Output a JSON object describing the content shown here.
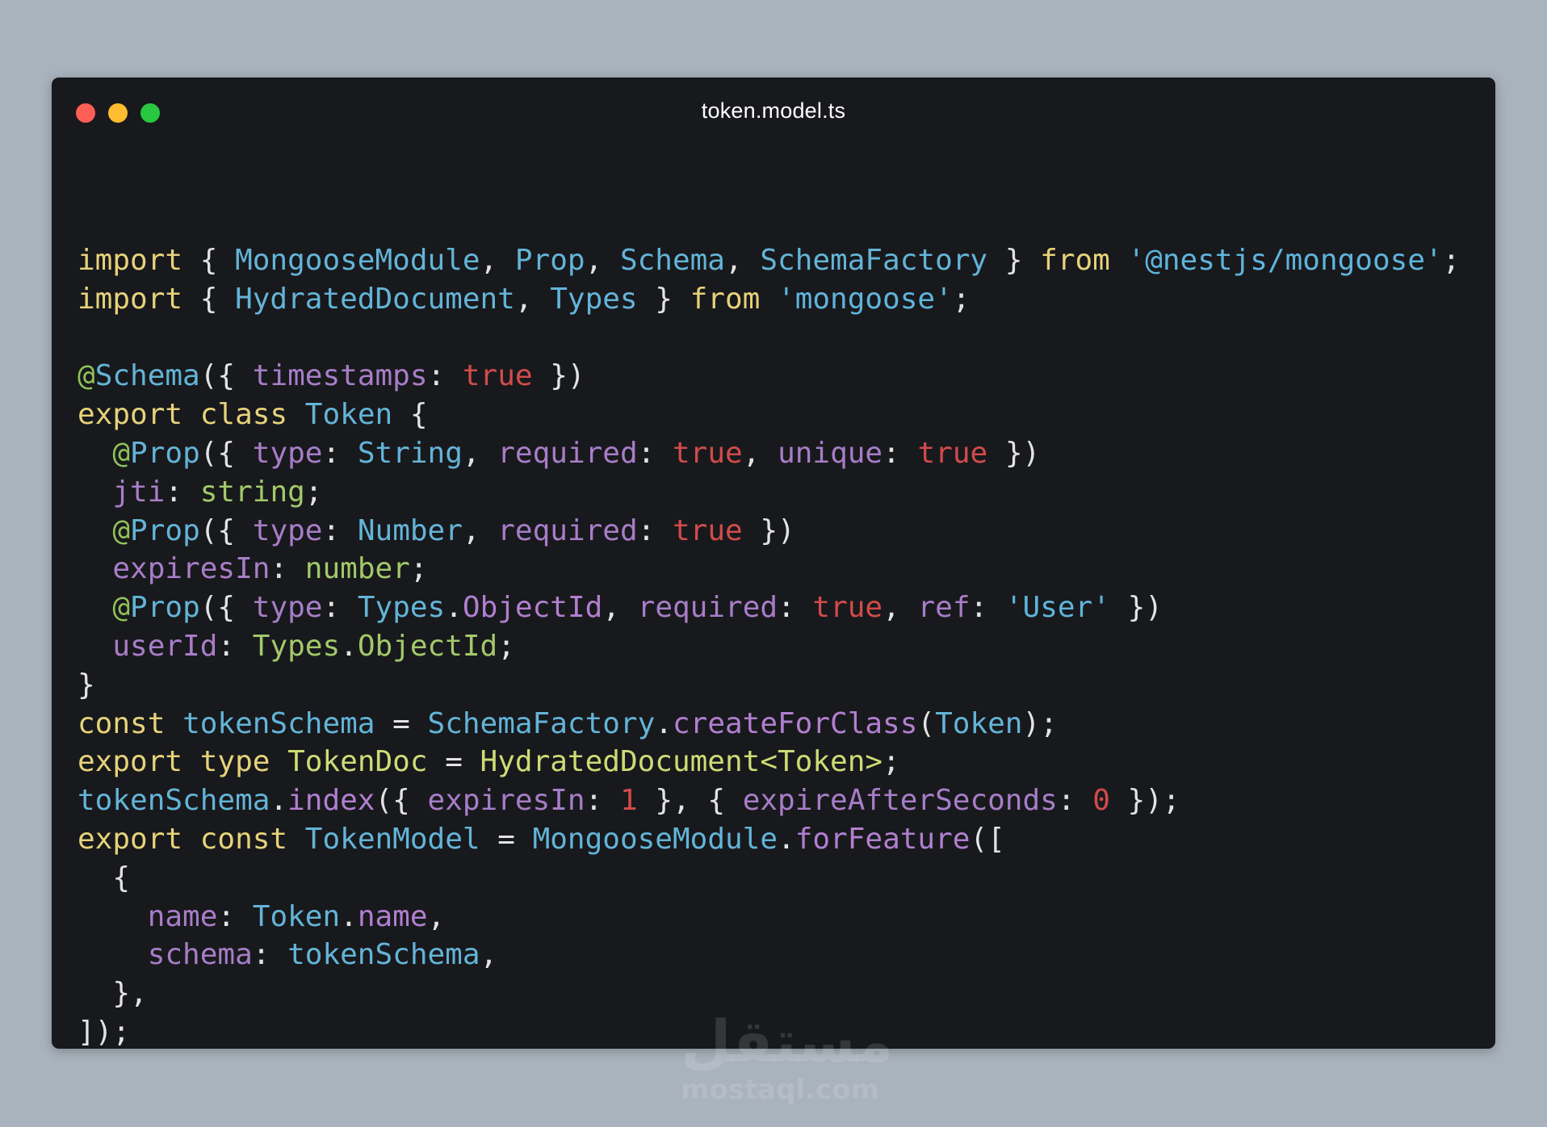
{
  "window": {
    "filename": "token.model.ts",
    "buttons": {
      "close": "close",
      "minimize": "minimize",
      "maximize": "maximize"
    }
  },
  "colors": {
    "background": "#a9b3bd",
    "editor": "#18191c",
    "keyword": "#e6d27a",
    "type": "#63b4d8",
    "string": "#5fb4dc",
    "property": "#a77dc8",
    "literal": "#d14b4b",
    "decorator": "#8fc35a",
    "primitive": "#a2c96b"
  },
  "code_lines": [
    [
      {
        "c": "keyword",
        "t": "import"
      },
      {
        "c": "plain",
        "t": " { "
      },
      {
        "c": "type",
        "t": "MongooseModule"
      },
      {
        "c": "plain",
        "t": ", "
      },
      {
        "c": "type",
        "t": "Prop"
      },
      {
        "c": "plain",
        "t": ", "
      },
      {
        "c": "type",
        "t": "Schema"
      },
      {
        "c": "plain",
        "t": ", "
      },
      {
        "c": "type",
        "t": "SchemaFactory"
      },
      {
        "c": "plain",
        "t": " } "
      },
      {
        "c": "keyword",
        "t": "from"
      },
      {
        "c": "plain",
        "t": " "
      },
      {
        "c": "string",
        "t": "'@nestjs/mongoose'"
      },
      {
        "c": "plain",
        "t": ";"
      }
    ],
    [
      {
        "c": "keyword",
        "t": "import"
      },
      {
        "c": "plain",
        "t": " { "
      },
      {
        "c": "type",
        "t": "HydratedDocument"
      },
      {
        "c": "plain",
        "t": ", "
      },
      {
        "c": "type",
        "t": "Types"
      },
      {
        "c": "plain",
        "t": " } "
      },
      {
        "c": "keyword",
        "t": "from"
      },
      {
        "c": "plain",
        "t": " "
      },
      {
        "c": "string",
        "t": "'mongoose'"
      },
      {
        "c": "plain",
        "t": ";"
      }
    ],
    [],
    [
      {
        "c": "decorator",
        "t": "@"
      },
      {
        "c": "type",
        "t": "Schema"
      },
      {
        "c": "plain",
        "t": "({ "
      },
      {
        "c": "prop",
        "t": "timestamps"
      },
      {
        "c": "plain",
        "t": ": "
      },
      {
        "c": "value",
        "t": "true"
      },
      {
        "c": "plain",
        "t": " })"
      }
    ],
    [
      {
        "c": "keyword",
        "t": "export"
      },
      {
        "c": "plain",
        "t": " "
      },
      {
        "c": "keyword",
        "t": "class"
      },
      {
        "c": "plain",
        "t": " "
      },
      {
        "c": "type",
        "t": "Token"
      },
      {
        "c": "plain",
        "t": " {"
      }
    ],
    [
      {
        "c": "plain",
        "t": "  "
      },
      {
        "c": "decorator",
        "t": "@"
      },
      {
        "c": "type",
        "t": "Prop"
      },
      {
        "c": "plain",
        "t": "({ "
      },
      {
        "c": "prop",
        "t": "type"
      },
      {
        "c": "plain",
        "t": ": "
      },
      {
        "c": "type",
        "t": "String"
      },
      {
        "c": "plain",
        "t": ", "
      },
      {
        "c": "prop",
        "t": "required"
      },
      {
        "c": "plain",
        "t": ": "
      },
      {
        "c": "value",
        "t": "true"
      },
      {
        "c": "plain",
        "t": ", "
      },
      {
        "c": "prop",
        "t": "unique"
      },
      {
        "c": "plain",
        "t": ": "
      },
      {
        "c": "value",
        "t": "true"
      },
      {
        "c": "plain",
        "t": " })"
      }
    ],
    [
      {
        "c": "plain",
        "t": "  "
      },
      {
        "c": "prop",
        "t": "jti"
      },
      {
        "c": "plain",
        "t": ": "
      },
      {
        "c": "prim",
        "t": "string"
      },
      {
        "c": "plain",
        "t": ";"
      }
    ],
    [
      {
        "c": "plain",
        "t": "  "
      },
      {
        "c": "decorator",
        "t": "@"
      },
      {
        "c": "type",
        "t": "Prop"
      },
      {
        "c": "plain",
        "t": "({ "
      },
      {
        "c": "prop",
        "t": "type"
      },
      {
        "c": "plain",
        "t": ": "
      },
      {
        "c": "type",
        "t": "Number"
      },
      {
        "c": "plain",
        "t": ", "
      },
      {
        "c": "prop",
        "t": "required"
      },
      {
        "c": "plain",
        "t": ": "
      },
      {
        "c": "value",
        "t": "true"
      },
      {
        "c": "plain",
        "t": " })"
      }
    ],
    [
      {
        "c": "plain",
        "t": "  "
      },
      {
        "c": "prop",
        "t": "expiresIn"
      },
      {
        "c": "plain",
        "t": ": "
      },
      {
        "c": "prim",
        "t": "number"
      },
      {
        "c": "plain",
        "t": ";"
      }
    ],
    [
      {
        "c": "plain",
        "t": "  "
      },
      {
        "c": "decorator",
        "t": "@"
      },
      {
        "c": "type",
        "t": "Prop"
      },
      {
        "c": "plain",
        "t": "({ "
      },
      {
        "c": "prop",
        "t": "type"
      },
      {
        "c": "plain",
        "t": ": "
      },
      {
        "c": "type",
        "t": "Types"
      },
      {
        "c": "plain",
        "t": "."
      },
      {
        "c": "method",
        "t": "ObjectId"
      },
      {
        "c": "plain",
        "t": ", "
      },
      {
        "c": "prop",
        "t": "required"
      },
      {
        "c": "plain",
        "t": ": "
      },
      {
        "c": "value",
        "t": "true"
      },
      {
        "c": "plain",
        "t": ", "
      },
      {
        "c": "prop",
        "t": "ref"
      },
      {
        "c": "plain",
        "t": ": "
      },
      {
        "c": "string",
        "t": "'User'"
      },
      {
        "c": "plain",
        "t": " })"
      }
    ],
    [
      {
        "c": "plain",
        "t": "  "
      },
      {
        "c": "prop",
        "t": "userId"
      },
      {
        "c": "plain",
        "t": ": "
      },
      {
        "c": "prim",
        "t": "Types"
      },
      {
        "c": "plain",
        "t": "."
      },
      {
        "c": "prim",
        "t": "ObjectId"
      },
      {
        "c": "plain",
        "t": ";"
      }
    ],
    [
      {
        "c": "plain",
        "t": "}"
      }
    ],
    [
      {
        "c": "keyword",
        "t": "const"
      },
      {
        "c": "plain",
        "t": " "
      },
      {
        "c": "type",
        "t": "tokenSchema"
      },
      {
        "c": "plain",
        "t": " = "
      },
      {
        "c": "type",
        "t": "SchemaFactory"
      },
      {
        "c": "plain",
        "t": "."
      },
      {
        "c": "method",
        "t": "createForClass"
      },
      {
        "c": "plain",
        "t": "("
      },
      {
        "c": "type",
        "t": "Token"
      },
      {
        "c": "plain",
        "t": ");"
      }
    ],
    [
      {
        "c": "keyword",
        "t": "export"
      },
      {
        "c": "plain",
        "t": " "
      },
      {
        "c": "keyword",
        "t": "type"
      },
      {
        "c": "plain",
        "t": " "
      },
      {
        "c": "class",
        "t": "TokenDoc"
      },
      {
        "c": "plain",
        "t": " = "
      },
      {
        "c": "class",
        "t": "HydratedDocument<Token>"
      },
      {
        "c": "plain",
        "t": ";"
      }
    ],
    [
      {
        "c": "type",
        "t": "tokenSchema"
      },
      {
        "c": "plain",
        "t": "."
      },
      {
        "c": "method",
        "t": "index"
      },
      {
        "c": "plain",
        "t": "({ "
      },
      {
        "c": "prop",
        "t": "expiresIn"
      },
      {
        "c": "plain",
        "t": ": "
      },
      {
        "c": "number",
        "t": "1"
      },
      {
        "c": "plain",
        "t": " }, { "
      },
      {
        "c": "prop",
        "t": "expireAfterSeconds"
      },
      {
        "c": "plain",
        "t": ": "
      },
      {
        "c": "number",
        "t": "0"
      },
      {
        "c": "plain",
        "t": " });"
      }
    ],
    [
      {
        "c": "keyword",
        "t": "export"
      },
      {
        "c": "plain",
        "t": " "
      },
      {
        "c": "keyword",
        "t": "const"
      },
      {
        "c": "plain",
        "t": " "
      },
      {
        "c": "type",
        "t": "TokenModel"
      },
      {
        "c": "plain",
        "t": " = "
      },
      {
        "c": "type",
        "t": "MongooseModule"
      },
      {
        "c": "plain",
        "t": "."
      },
      {
        "c": "method",
        "t": "forFeature"
      },
      {
        "c": "plain",
        "t": "(["
      }
    ],
    [
      {
        "c": "plain",
        "t": "  {"
      }
    ],
    [
      {
        "c": "plain",
        "t": "    "
      },
      {
        "c": "prop",
        "t": "name"
      },
      {
        "c": "plain",
        "t": ": "
      },
      {
        "c": "type",
        "t": "Token"
      },
      {
        "c": "plain",
        "t": "."
      },
      {
        "c": "method",
        "t": "name"
      },
      {
        "c": "plain",
        "t": ","
      }
    ],
    [
      {
        "c": "plain",
        "t": "    "
      },
      {
        "c": "prop",
        "t": "schema"
      },
      {
        "c": "plain",
        "t": ": "
      },
      {
        "c": "type",
        "t": "tokenSchema"
      },
      {
        "c": "plain",
        "t": ","
      }
    ],
    [
      {
        "c": "plain",
        "t": "  },"
      }
    ],
    [
      {
        "c": "plain",
        "t": "]);"
      }
    ]
  ],
  "watermark": {
    "arabic": "مستقل",
    "latin": "mostaql.com"
  }
}
